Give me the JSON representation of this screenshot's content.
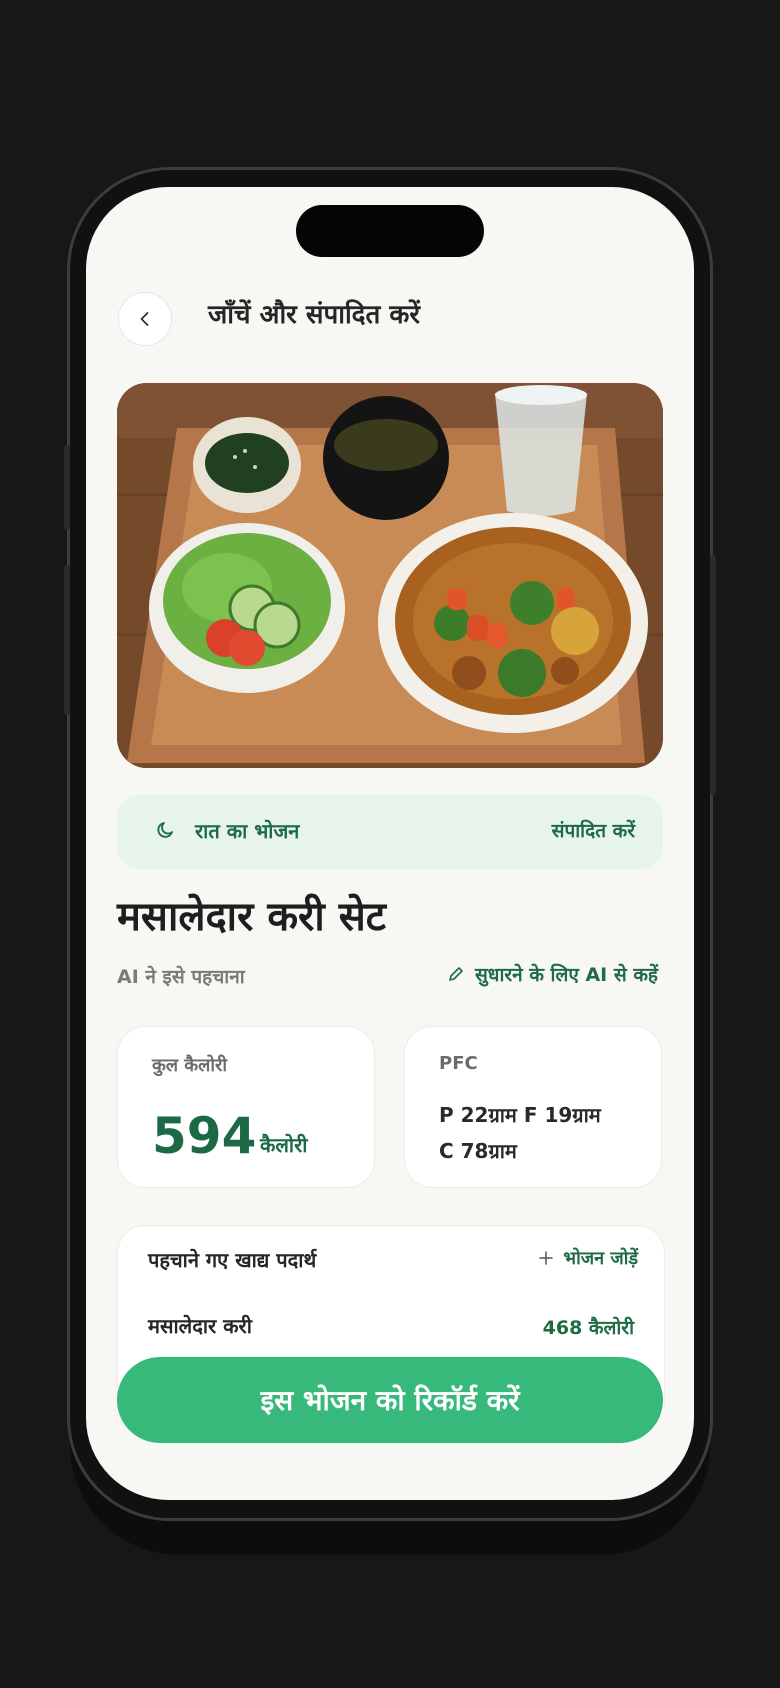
{
  "header": {
    "title": "जाँचें और संपादित करें"
  },
  "meal": {
    "type": "रात का भोजन",
    "edit_label": "संपादित करें"
  },
  "dish": {
    "title": "मसालेदार करी सेट",
    "ai_label": "AI ने इसे पहचाना",
    "ai_fix_label": "सुधारने के लिए AI से कहें"
  },
  "calories": {
    "label": "कुल कैलोरी",
    "value": "594",
    "unit": "कैलोरी"
  },
  "pfc": {
    "label": "PFC",
    "line1": "P 22ग्राम  F 19ग्राम",
    "line2": "C 78ग्राम"
  },
  "foods": {
    "title": "पहचाने गए खाद्य पदार्थ",
    "add_label": "भोजन जोड़ें",
    "items": [
      {
        "name": "मसालेदार करी",
        "kcal": "468 कैलोरी"
      }
    ]
  },
  "actions": {
    "record_label": "इस भोजन को रिकॉर्ड करें"
  },
  "icons": [
    "chevron-left-icon",
    "moon-icon",
    "pencil-icon",
    "plus-icon",
    "meal-photo"
  ],
  "colors": {
    "accent": "#37b97b",
    "accent_dark": "#1f6b45",
    "meal_bar": "#e6f4ec",
    "background": "#f7f7f3"
  }
}
